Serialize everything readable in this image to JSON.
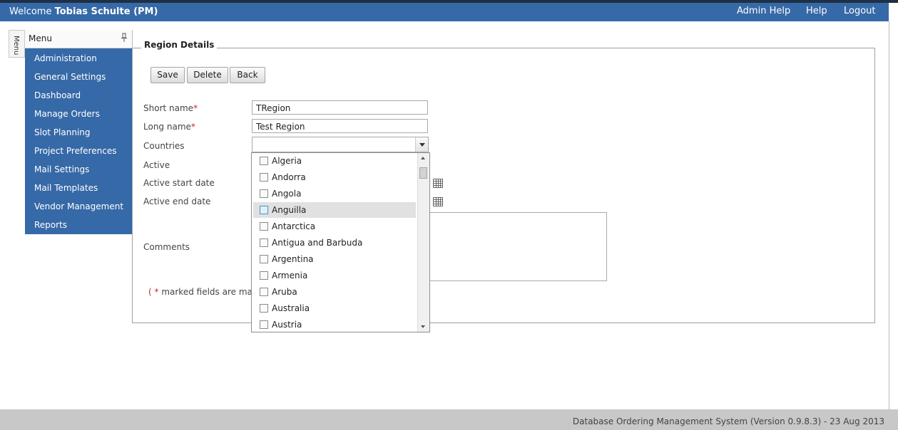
{
  "header": {
    "welcome_prefix": "Welcome",
    "user_name": "Tobias Schulte (PM)",
    "links": [
      "Admin Help",
      "Help",
      "Logout"
    ]
  },
  "side_menu": {
    "tab_label": "Menu",
    "title": "Menu",
    "items": [
      "Administration",
      "General Settings",
      "Dashboard",
      "Manage Orders",
      "Slot Planning",
      "Project Preferences",
      "Mail Settings",
      "Mail Templates",
      "Vendor Management",
      "Reports"
    ]
  },
  "form": {
    "legend": "Region Details",
    "buttons": {
      "save": "Save",
      "delete": "Delete",
      "back": "Back"
    },
    "short_name_label": "Short name",
    "short_name_value": "TRegion",
    "long_name_label": "Long name",
    "long_name_value": "Test Region",
    "required_marker": "*",
    "countries_label": "Countries",
    "countries_value": "",
    "active_label": "Active",
    "active_start_label": "Active start date",
    "active_end_label": "Active end date",
    "comments_label": "Comments",
    "mandatory_note_open": "(",
    "mandatory_note_text": " marked fields are manda"
  },
  "countries_dropdown": {
    "options": [
      "Algeria",
      "Andorra",
      "Angola",
      "Anguilla",
      "Antarctica",
      "Antigua and Barbuda",
      "Argentina",
      "Armenia",
      "Aruba",
      "Australia",
      "Austria"
    ],
    "highlighted": "Anguilla"
  },
  "footer": {
    "text": "Database Ordering Management System (Version 0.9.8.3) - 23 Aug 2013"
  },
  "colors": {
    "header": "#3669a7",
    "menu": "#3669a7",
    "required": "#c62828",
    "footer": "#c8c8c8"
  }
}
